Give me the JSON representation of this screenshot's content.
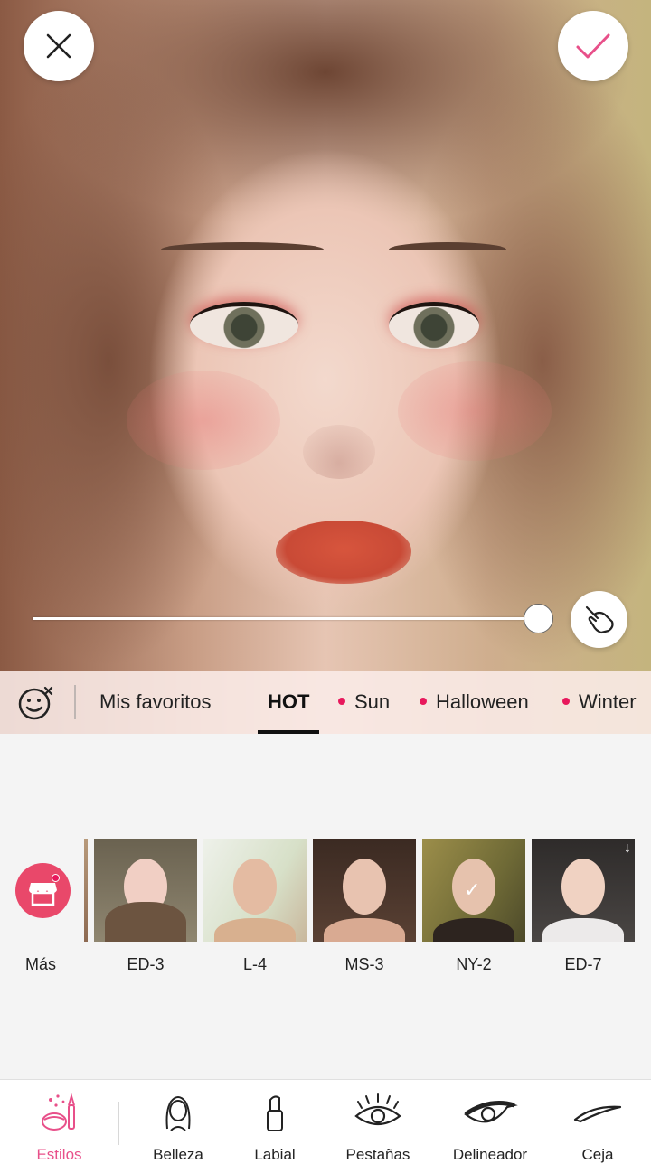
{
  "actions": {
    "close_icon": "close-icon",
    "confirm_icon": "check-icon",
    "compare_icon": "hand-pointer-icon"
  },
  "intensity_slider": {
    "value": 100
  },
  "tabs": {
    "items": [
      {
        "label": "Mis favoritos",
        "dot": false,
        "active": false
      },
      {
        "label": "HOT",
        "dot": false,
        "active": true
      },
      {
        "label": "Sun",
        "dot": true,
        "active": false
      },
      {
        "label": "Halloween",
        "dot": true,
        "active": false
      },
      {
        "label": "Winter",
        "dot": true,
        "active": false
      }
    ]
  },
  "styles": {
    "more_label": "Más",
    "items": [
      {
        "label": "ED-3",
        "selected": false
      },
      {
        "label": "L-4",
        "selected": false
      },
      {
        "label": "MS-3",
        "selected": false
      },
      {
        "label": "NY-2",
        "selected": true
      },
      {
        "label": "ED-7",
        "selected": false,
        "downloadable": true
      }
    ]
  },
  "bottom_nav": {
    "items": [
      {
        "label": "Estilos",
        "icon": "makeup-kit-icon",
        "active": true
      },
      {
        "label": "Belleza",
        "icon": "face-portrait-icon",
        "active": false
      },
      {
        "label": "Labial",
        "icon": "lipstick-icon",
        "active": false
      },
      {
        "label": "Pestañas",
        "icon": "eyelash-icon",
        "active": false
      },
      {
        "label": "Delineador",
        "icon": "eyeliner-icon",
        "active": false
      },
      {
        "label": "Ceja",
        "icon": "eyebrow-icon",
        "active": false
      }
    ]
  },
  "colors": {
    "accent": "#e8508a",
    "tab_dot": "#e8185c",
    "more_button": "#e9486a"
  }
}
